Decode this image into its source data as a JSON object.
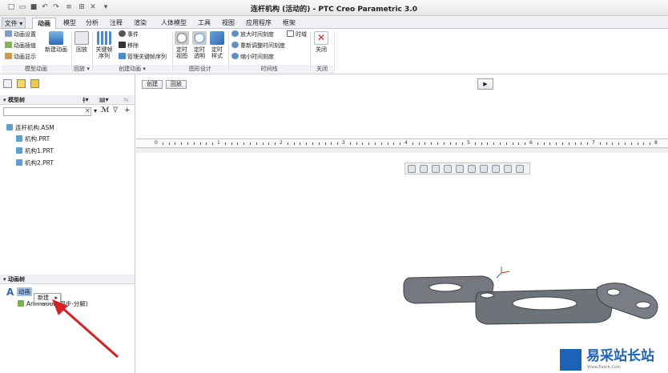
{
  "window": {
    "title": "连杆机构 (活动的) - PTC Creo Parametric 3.0"
  },
  "quick_access": [
    "new-icon",
    "open-icon",
    "save-icon",
    "undo-icon",
    "redo-icon",
    "regenerate-icon",
    "windows-icon",
    "close-icon",
    "customize-icon"
  ],
  "tabs": [
    {
      "label": "文件 ▾",
      "kind": "file"
    },
    {
      "label": "动画",
      "active": true
    },
    {
      "label": "模型"
    },
    {
      "label": "分析"
    },
    {
      "label": "注释"
    },
    {
      "label": "渲染"
    },
    {
      "label": "人体模型"
    },
    {
      "label": "工具"
    },
    {
      "label": "视图"
    },
    {
      "label": "应用程序"
    },
    {
      "label": "框架"
    }
  ],
  "ribbon": {
    "model_anim": {
      "items": [
        "动画设置",
        "动画插值",
        "动画显示"
      ],
      "group": "模型动画"
    },
    "new_anim": {
      "label": "新建动画"
    },
    "playback": {
      "label": "回放",
      "group": "回放 ▾"
    },
    "keyframe": {
      "label": "关键帧序列"
    },
    "create": {
      "items": [
        "事件",
        "移除",
        "管理关键帧序列"
      ],
      "group": "创建动画 ▾"
    },
    "graph": {
      "items": [
        "定时视图",
        "定时透明",
        "定时样式"
      ],
      "group": "图形设计"
    },
    "timeline": {
      "items": [
        "放大时间刻度",
        "重新调整时间刻度",
        "缩小时间刻度"
      ],
      "toggle": "时域",
      "group": "时间线"
    },
    "close": {
      "label": "关闭",
      "group": "关闭"
    }
  },
  "sidebar": {
    "model_tree": {
      "header": "模型树",
      "search_placeholder": "",
      "items": [
        "连杆机构.ASM",
        "机构.PRT",
        "机构1.PRT",
        "机构2.PRT"
      ]
    },
    "anim_tree": {
      "header": "动画树",
      "root": "动画",
      "child": "Animation",
      "child_suffix": "(同步-分解)"
    }
  },
  "context_menu": {
    "item": "新建",
    "arrow": "▸"
  },
  "anim_panel": {
    "create_btn": "创建",
    "playback_btn": "回放",
    "play_icon": "▶"
  },
  "ruler": {
    "labels": [
      "0",
      "1",
      "2",
      "3",
      "4",
      "5",
      "6",
      "7",
      "8"
    ]
  },
  "watermark": {
    "text": "易采站长站",
    "sub": "Www.Easck.Com"
  },
  "colors": {
    "accent": "#2b6cb8",
    "part": "#6e7379",
    "arrow": "#d42222"
  }
}
